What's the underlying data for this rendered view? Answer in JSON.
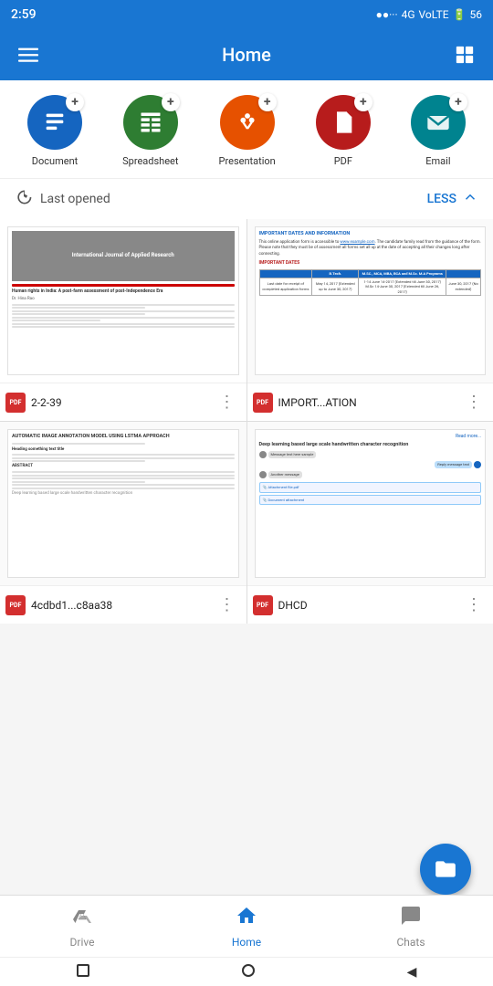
{
  "statusBar": {
    "time": "2:59",
    "signal": "....||||",
    "networkType": "4G",
    "battery": "56"
  },
  "appBar": {
    "title": "Home",
    "menuIconLabel": "menu",
    "gridIconLabel": "grid-view"
  },
  "quickActions": [
    {
      "id": "document",
      "label": "Document",
      "color": "#1565c0",
      "iconSymbol": "≡",
      "hasBadge": true
    },
    {
      "id": "spreadsheet",
      "label": "Spreadsheet",
      "color": "#2e7d32",
      "iconSymbol": "⊞",
      "hasBadge": true
    },
    {
      "id": "presentation",
      "label": "Presentation",
      "color": "#e65100",
      "iconSymbol": "⬡",
      "hasBadge": true
    },
    {
      "id": "pdf",
      "label": "PDF",
      "color": "#b71c1c",
      "iconSymbol": "✳",
      "hasBadge": true
    },
    {
      "id": "email",
      "label": "Email",
      "color": "#00838f",
      "iconSymbol": "✉",
      "hasBadge": true
    }
  ],
  "sectionHeader": {
    "icon": "history",
    "label": "Last opened",
    "actionLabel": "LESS",
    "collapseIcon": "chevron-up"
  },
  "files": [
    {
      "id": "file1",
      "name": "2-2-39",
      "type": "pdf",
      "thumbnail": "research"
    },
    {
      "id": "file2",
      "name": "IMPORT...ATION",
      "type": "pdf",
      "thumbnail": "table"
    },
    {
      "id": "file3",
      "name": "4cdbd1...c8aa38",
      "type": "pdf",
      "thumbnail": "text"
    },
    {
      "id": "file4",
      "name": "DHCD",
      "type": "pdf",
      "thumbnail": "chat"
    }
  ],
  "fab": {
    "icon": "folder",
    "label": "new folder"
  },
  "bottomNav": [
    {
      "id": "drive",
      "label": "Drive",
      "icon": "drive",
      "active": false
    },
    {
      "id": "home",
      "label": "Home",
      "icon": "home",
      "active": true
    },
    {
      "id": "chats",
      "label": "Chats",
      "icon": "chat",
      "active": false
    }
  ],
  "androidNav": [
    {
      "id": "square",
      "symbol": "■"
    },
    {
      "id": "circle",
      "symbol": "●"
    },
    {
      "id": "triangle",
      "symbol": "◀"
    }
  ]
}
